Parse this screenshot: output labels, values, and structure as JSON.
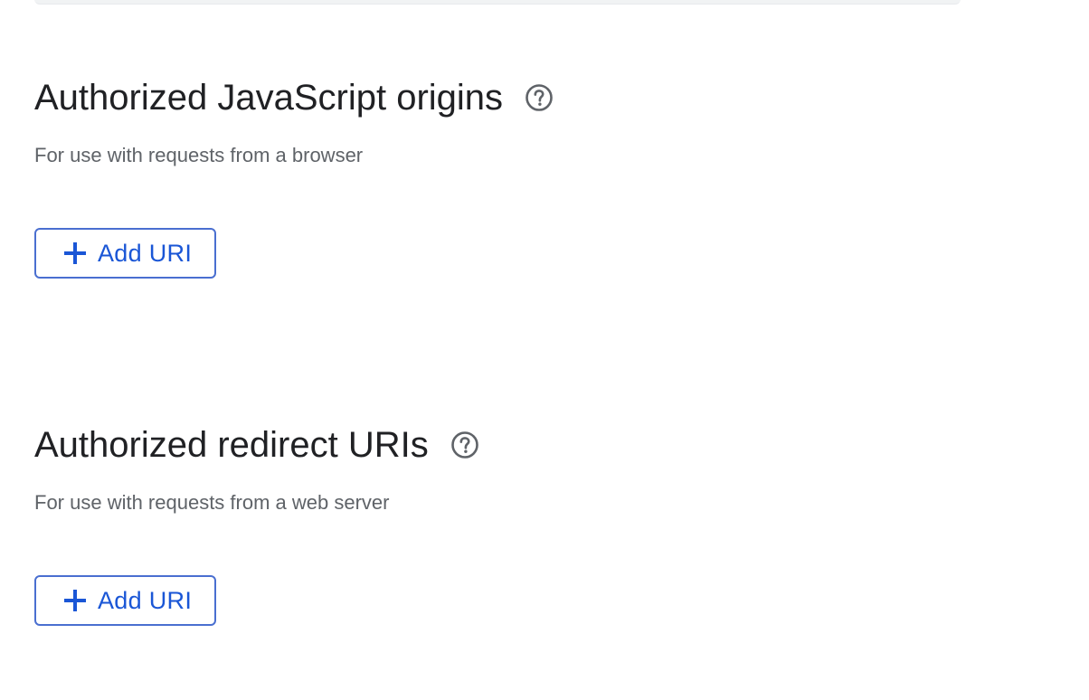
{
  "js_origins": {
    "title": "Authorized JavaScript origins",
    "help_icon": "help-circle-icon",
    "subtitle": "For use with requests from a browser",
    "add_button": {
      "icon": "plus-icon",
      "label": "Add URI"
    }
  },
  "redirect_uris": {
    "title": "Authorized redirect URIs",
    "help_icon": "help-circle-icon",
    "subtitle": "For use with requests from a web server",
    "add_button": {
      "icon": "plus-icon",
      "label": "Add URI"
    }
  },
  "colors": {
    "heading": "#202124",
    "subtitle": "#5f6368",
    "accent": "#1a56d6",
    "button_border": "#4a6fd0",
    "icon": "#5f6368"
  }
}
